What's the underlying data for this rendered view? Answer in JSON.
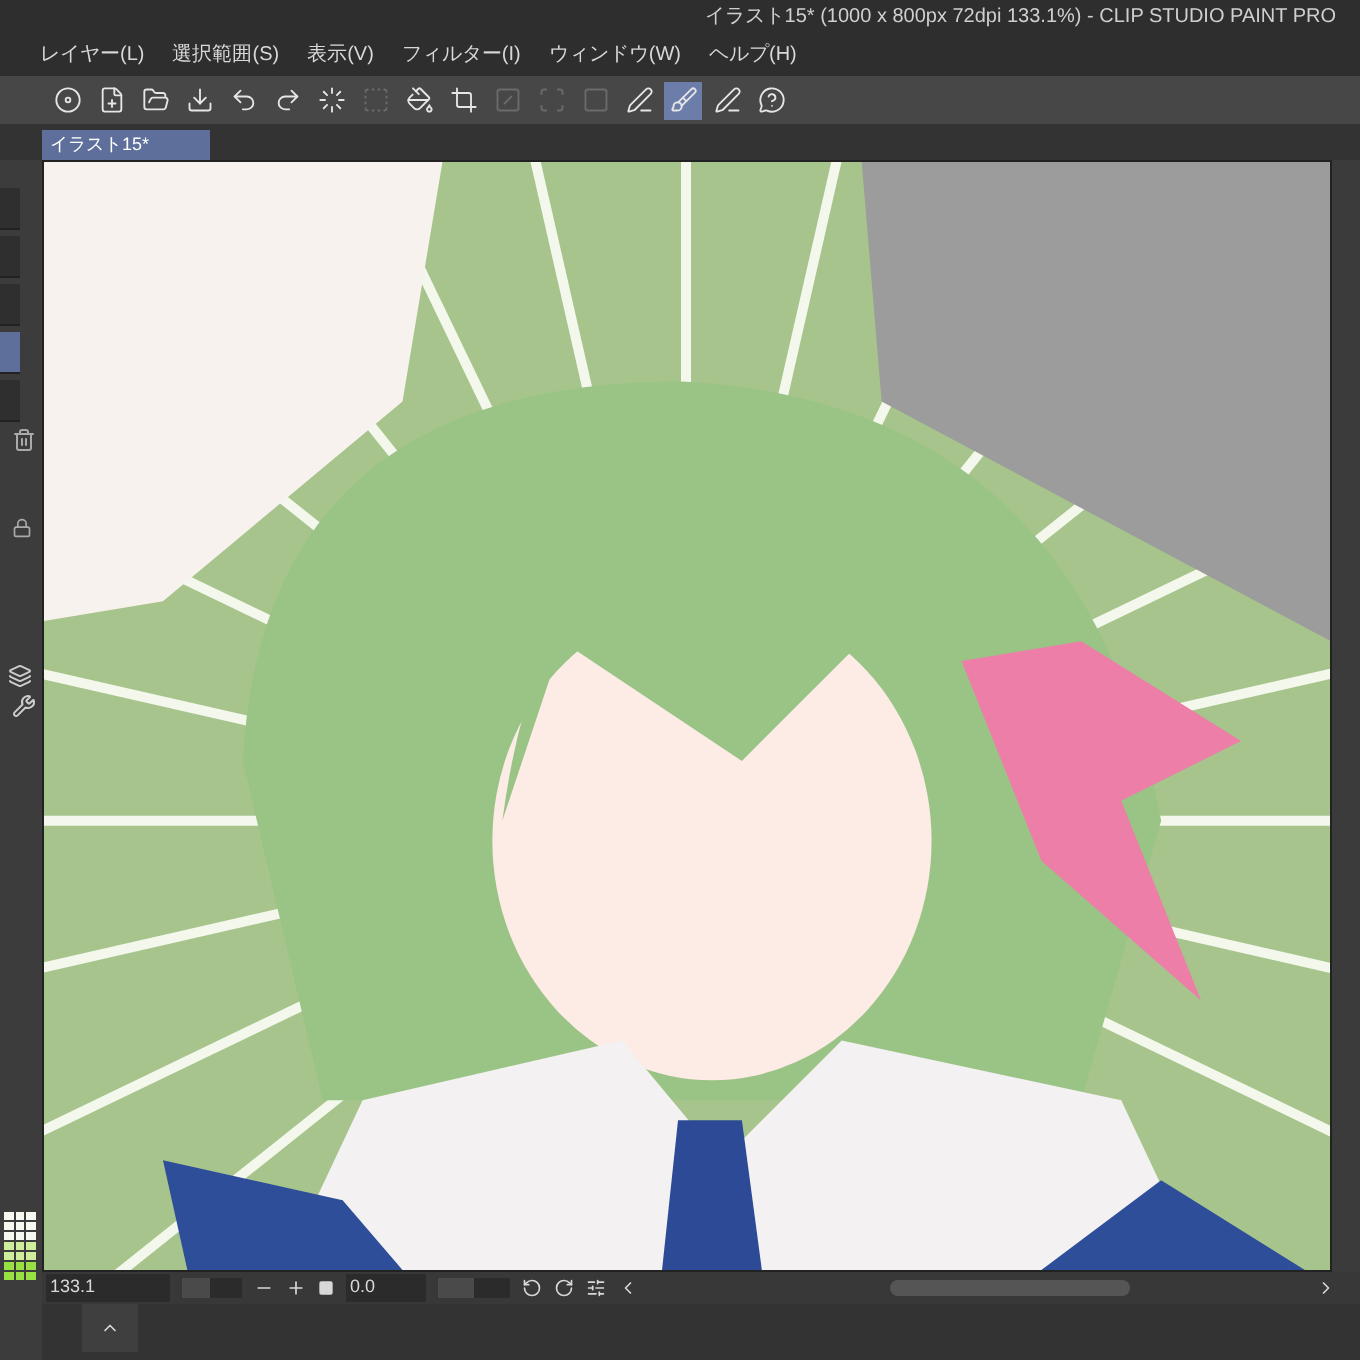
{
  "window": {
    "title": "イラスト15* (1000 x 800px 72dpi 133.1%)  - CLIP STUDIO PAINT PRO"
  },
  "menu": [
    "レイヤー(L)",
    "選択範囲(S)",
    "表示(V)",
    "フィルター(I)",
    "ウィンドウ(W)",
    "ヘルプ(H)"
  ],
  "toolbar": [
    {
      "selected": false,
      "disabled": false
    },
    {
      "selected": false,
      "disabled": false
    },
    {
      "selected": false,
      "disabled": false
    },
    {
      "selected": false,
      "disabled": false
    },
    {
      "selected": false,
      "disabled": false
    },
    {
      "selected": false,
      "disabled": false
    },
    {
      "selected": false,
      "disabled": false
    },
    {
      "selected": false,
      "disabled": true
    },
    {
      "selected": false,
      "disabled": false
    },
    {
      "selected": false,
      "disabled": false
    },
    {
      "selected": false,
      "disabled": true
    },
    {
      "selected": false,
      "disabled": true
    },
    {
      "selected": false,
      "disabled": true
    },
    {
      "selected": false,
      "disabled": false
    },
    {
      "selected": true,
      "disabled": false
    },
    {
      "selected": false,
      "disabled": false
    },
    {
      "selected": false,
      "disabled": false
    }
  ],
  "document_tab": {
    "label": "イラスト15*",
    "selected": true
  },
  "layers": [
    {
      "selected": false
    },
    {
      "selected": false
    },
    {
      "selected": false
    },
    {
      "selected": true
    },
    {
      "selected": false
    }
  ],
  "status_bar": {
    "zoom": "133.1",
    "zoom_slider": {
      "level": 0.45
    },
    "rotation": "0.0",
    "rotation_slider": {
      "level": 0.5
    }
  }
}
